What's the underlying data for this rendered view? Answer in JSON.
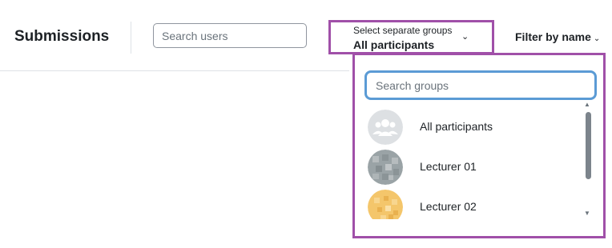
{
  "header": {
    "title": "Submissions",
    "search_placeholder": "Search users",
    "group_selector": {
      "label": "Select separate groups",
      "value": "All participants"
    },
    "filter_by_name": "Filter by name"
  },
  "group_dropdown": {
    "search_placeholder": "Search groups",
    "items": [
      {
        "label": "All participants",
        "avatar": "group-placeholder"
      },
      {
        "label": "Lecturer 01",
        "avatar": "grey-pattern"
      },
      {
        "label": "Lecturer 02",
        "avatar": "orange-pattern"
      }
    ]
  },
  "colors": {
    "highlight_border": "#a050a8",
    "focus_border": "#5b9bd5",
    "text": "#1d2125"
  }
}
